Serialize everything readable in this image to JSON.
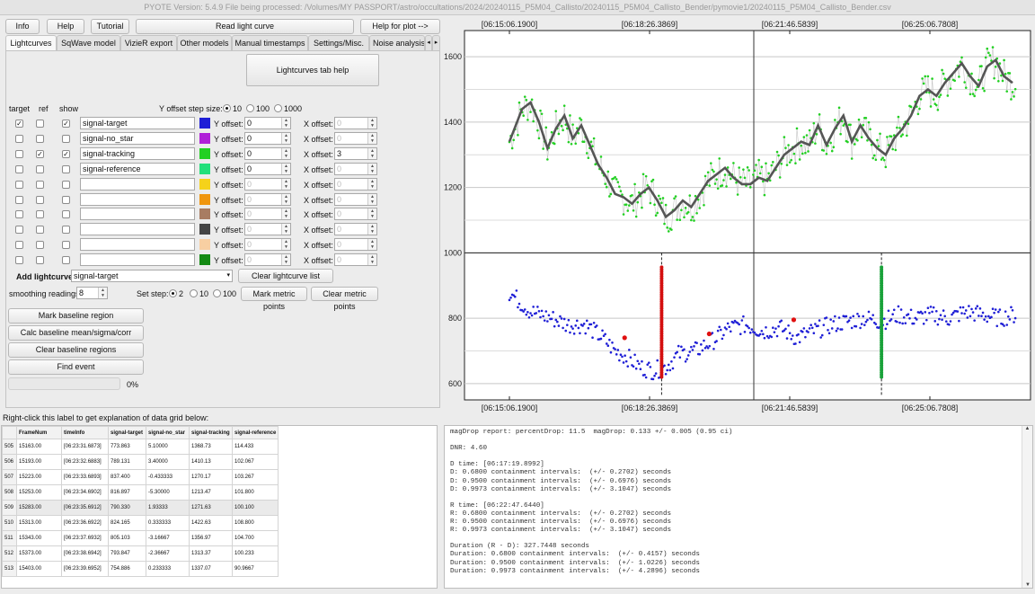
{
  "title": "PYOTE Version: 5.4.9   File being processed: /Volumes/MY PASSPORT/astro/occultations/2024/20240115_P5M04_Callisto/20240115_P5M04_Callisto_Bender/pymovie1/20240115_P5M04_Callisto_Bender.csv",
  "toolbar": {
    "info": "Info",
    "help": "Help",
    "tutorial": "Tutorial",
    "read": "Read light curve",
    "plot_help": "Help for plot -->"
  },
  "tabs": [
    "Lightcurves",
    "SqWave model",
    "VizieR export",
    "Other models",
    "Manual timestamps",
    "Settings/Misc.",
    "Noise analysis/"
  ],
  "tab_arrows": {
    "left": "◂",
    "right": "▸"
  },
  "lightcurves_help": "Lightcurves tab help",
  "headers": {
    "target": "target",
    "ref": "ref",
    "show": "show"
  },
  "offset_step_label": "Y offset step size:",
  "offset_steps": [
    "10",
    "100",
    "1000"
  ],
  "yoffset_label": "Y offset:",
  "xoffset_label": "X offset:",
  "rows": [
    {
      "name": "signal-target",
      "color": "#1f1fd6",
      "target": "✓",
      "ref": "",
      "show": "✓",
      "y": "0",
      "x": "0",
      "xdis": true
    },
    {
      "name": "signal-no_star",
      "color": "#b020d8",
      "target": "",
      "ref": "",
      "show": "",
      "y": "0",
      "x": "0",
      "xdis": true
    },
    {
      "name": "signal-tracking",
      "color": "#22d022",
      "target": "",
      "ref": "✓",
      "show": "✓",
      "y": "0",
      "x": "3",
      "xdis": false
    },
    {
      "name": "signal-reference",
      "color": "#22e07a",
      "target": "",
      "ref": "",
      "show": "",
      "y": "0",
      "x": "0",
      "xdis": true
    },
    {
      "name": "",
      "color": "#f5d21a",
      "target": "",
      "ref": "",
      "show": "",
      "y": "0",
      "x": "0",
      "xdis": true
    },
    {
      "name": "",
      "color": "#f0960f",
      "target": "",
      "ref": "",
      "show": "",
      "y": "0",
      "x": "0",
      "xdis": true
    },
    {
      "name": "",
      "color": "#a87c62",
      "target": "",
      "ref": "",
      "show": "",
      "y": "0",
      "x": "0",
      "xdis": true
    },
    {
      "name": "",
      "color": "#444444",
      "target": "",
      "ref": "",
      "show": "",
      "y": "0",
      "x": "0",
      "xdis": true
    },
    {
      "name": "",
      "color": "#f8cfa2",
      "target": "",
      "ref": "",
      "show": "",
      "y": "0",
      "x": "0",
      "xdis": true
    },
    {
      "name": "",
      "color": "#138a13",
      "target": "",
      "ref": "",
      "show": "",
      "y": "0",
      "x": "0",
      "xdis": true
    }
  ],
  "add_lightcurve_label": "Add lightcurve",
  "add_lightcurve_value": "signal-target",
  "clear_list": "Clear lightcurve list",
  "smoothing_label": "smoothing readings",
  "smoothing_value": "8",
  "set_step_label": "Set step:",
  "set_steps": [
    "2",
    "10",
    "100"
  ],
  "mark_metric": "Mark metric points",
  "clear_metric": "Clear metric points",
  "mark_baseline": "Mark baseline region",
  "calc_baseline": "Calc baseline mean/sigma/corr coeffs",
  "clear_baseline": "Clear baseline regions",
  "find_event": "Find event",
  "progress_text": "0%",
  "progress_fraction": 0,
  "grid_hint": "Right-click this label to get explanation of data grid below:",
  "grid_columns": [
    "FrameNum",
    "timeInfo",
    "signal-target",
    "signal-no_star",
    "signal-tracking",
    "signal-reference"
  ],
  "grid_rows": [
    [
      "505",
      "15163.00",
      "[06:23:31.6873]",
      "773.863",
      "5.10000",
      "1368.73",
      "114.433"
    ],
    [
      "506",
      "15193.00",
      "[06:23:32.6883]",
      "789.131",
      "3.40000",
      "1410.13",
      "102.067"
    ],
    [
      "507",
      "15223.00",
      "[06:23:33.6893]",
      "837.400",
      "-0.433333",
      "1270.17",
      "103.267"
    ],
    [
      "508",
      "15253.00",
      "[06:23:34.6902]",
      "816.897",
      "-5.30000",
      "1213.47",
      "101.800"
    ],
    [
      "509",
      "15283.00",
      "[06:23:35.6912]",
      "790.330",
      "1.93333",
      "1271.63",
      "100.100"
    ],
    [
      "510",
      "15313.00",
      "[06:23:36.6922]",
      "824.165",
      "0.333333",
      "1422.63",
      "108.800"
    ],
    [
      "511",
      "15343.00",
      "[06:23:37.6932]",
      "805.103",
      "-3.16667",
      "1356.97",
      "104.700"
    ],
    [
      "512",
      "15373.00",
      "[06:23:38.6942]",
      "793.847",
      "-2.36667",
      "1313.37",
      "100.233"
    ],
    [
      "513",
      "15403.00",
      "[06:23:39.6952]",
      "754.886",
      "0.233333",
      "1337.07",
      "90.9667"
    ]
  ],
  "report_lines": [
    "magDrop report: percentDrop: 11.5  magDrop: 0.133 +/- 0.005 (0.95 ci)",
    "",
    "DNR: 4.60",
    "",
    "D time: [06:17:19.8992]",
    "D: 0.6800 containment intervals:  (+/- 0.2702) seconds",
    "D: 0.9500 containment intervals:  (+/- 0.6976) seconds",
    "D: 0.9973 containment intervals:  (+/- 3.1047) seconds",
    "",
    "R time: [06:22:47.6440]",
    "R: 0.6800 containment intervals:  (+/- 0.2702) seconds",
    "R: 0.9500 containment intervals:  (+/- 0.6976) seconds",
    "R: 0.9973 containment intervals:  (+/- 3.1047) seconds",
    "",
    "Duration (R - D): 327.7448 seconds",
    "Duration: 0.6800 containment intervals:  (+/- 0.4157) seconds",
    "Duration: 0.9500 containment intervals:  (+/- 1.0226) seconds",
    "Duration: 0.9973 containment intervals:  (+/- 4.2896) seconds"
  ],
  "chart_data": {
    "type": "scatter",
    "x_ticks": [
      "[06:15:06.1900]",
      "[06:18:26.3869]",
      "[06:21:46.5839]",
      "[06:25:06.7808]"
    ],
    "y_ticks_top": [
      "1000",
      "1200",
      "1400",
      "1600"
    ],
    "y_ticks_bottom": [
      "600",
      "800"
    ],
    "ylim": [
      550,
      1680
    ],
    "series": [
      {
        "name": "signal-tracking",
        "color": "#22d022",
        "trend": [
          [
            0,
            1340
          ],
          [
            3,
            1440
          ],
          [
            5,
            1460
          ],
          [
            7,
            1400
          ],
          [
            9,
            1320
          ],
          [
            11,
            1380
          ],
          [
            13,
            1420
          ],
          [
            15,
            1350
          ],
          [
            17,
            1390
          ],
          [
            19,
            1330
          ],
          [
            21,
            1270
          ],
          [
            23,
            1230
          ],
          [
            25,
            1180
          ],
          [
            27,
            1170
          ],
          [
            29,
            1150
          ],
          [
            31,
            1180
          ],
          [
            33,
            1200
          ],
          [
            35,
            1160
          ],
          [
            37,
            1110
          ],
          [
            39,
            1130
          ],
          [
            41,
            1160
          ],
          [
            43,
            1140
          ],
          [
            45,
            1180
          ],
          [
            47,
            1220
          ],
          [
            49,
            1240
          ],
          [
            51,
            1260
          ],
          [
            53,
            1230
          ],
          [
            55,
            1210
          ],
          [
            57,
            1210
          ],
          [
            59,
            1230
          ],
          [
            61,
            1220
          ],
          [
            63,
            1260
          ],
          [
            65,
            1300
          ],
          [
            67,
            1320
          ],
          [
            69,
            1340
          ],
          [
            71,
            1330
          ],
          [
            73,
            1390
          ],
          [
            75,
            1330
          ],
          [
            77,
            1380
          ],
          [
            79,
            1420
          ],
          [
            81,
            1340
          ],
          [
            83,
            1390
          ],
          [
            85,
            1350
          ],
          [
            87,
            1320
          ],
          [
            89,
            1300
          ],
          [
            91,
            1350
          ],
          [
            93,
            1380
          ],
          [
            95,
            1420
          ],
          [
            97,
            1480
          ],
          [
            99,
            1500
          ],
          [
            101,
            1480
          ],
          [
            103,
            1520
          ],
          [
            105,
            1550
          ],
          [
            107,
            1580
          ],
          [
            109,
            1540
          ],
          [
            111,
            1510
          ],
          [
            113,
            1570
          ],
          [
            115,
            1590
          ],
          [
            117,
            1540
          ],
          [
            119,
            1520
          ]
        ]
      },
      {
        "name": "signal-target",
        "color": "#1f1fd6",
        "trend": [
          [
            0,
            880
          ],
          [
            5,
            820
          ],
          [
            10,
            800
          ],
          [
            14,
            780
          ],
          [
            18,
            780
          ],
          [
            20,
            760
          ],
          [
            22,
            740
          ],
          [
            25,
            700
          ],
          [
            28,
            680
          ],
          [
            31,
            650
          ],
          [
            34,
            640
          ],
          [
            37,
            650
          ],
          [
            40,
            690
          ],
          [
            44,
            700
          ],
          [
            48,
            730
          ],
          [
            52,
            770
          ],
          [
            56,
            780
          ],
          [
            60,
            760
          ],
          [
            64,
            770
          ],
          [
            68,
            740
          ],
          [
            72,
            760
          ],
          [
            76,
            780
          ],
          [
            80,
            790
          ],
          [
            84,
            800
          ],
          [
            88,
            790
          ],
          [
            92,
            810
          ],
          [
            96,
            800
          ],
          [
            100,
            810
          ],
          [
            104,
            800
          ],
          [
            108,
            820
          ],
          [
            112,
            810
          ],
          [
            116,
            800
          ],
          [
            119,
            810
          ]
        ]
      }
    ],
    "event_markers": [
      {
        "label": "D",
        "color": "#d41010",
        "x": 36
      },
      {
        "label": "R",
        "color": "#1aa23a",
        "x": 88
      }
    ]
  }
}
